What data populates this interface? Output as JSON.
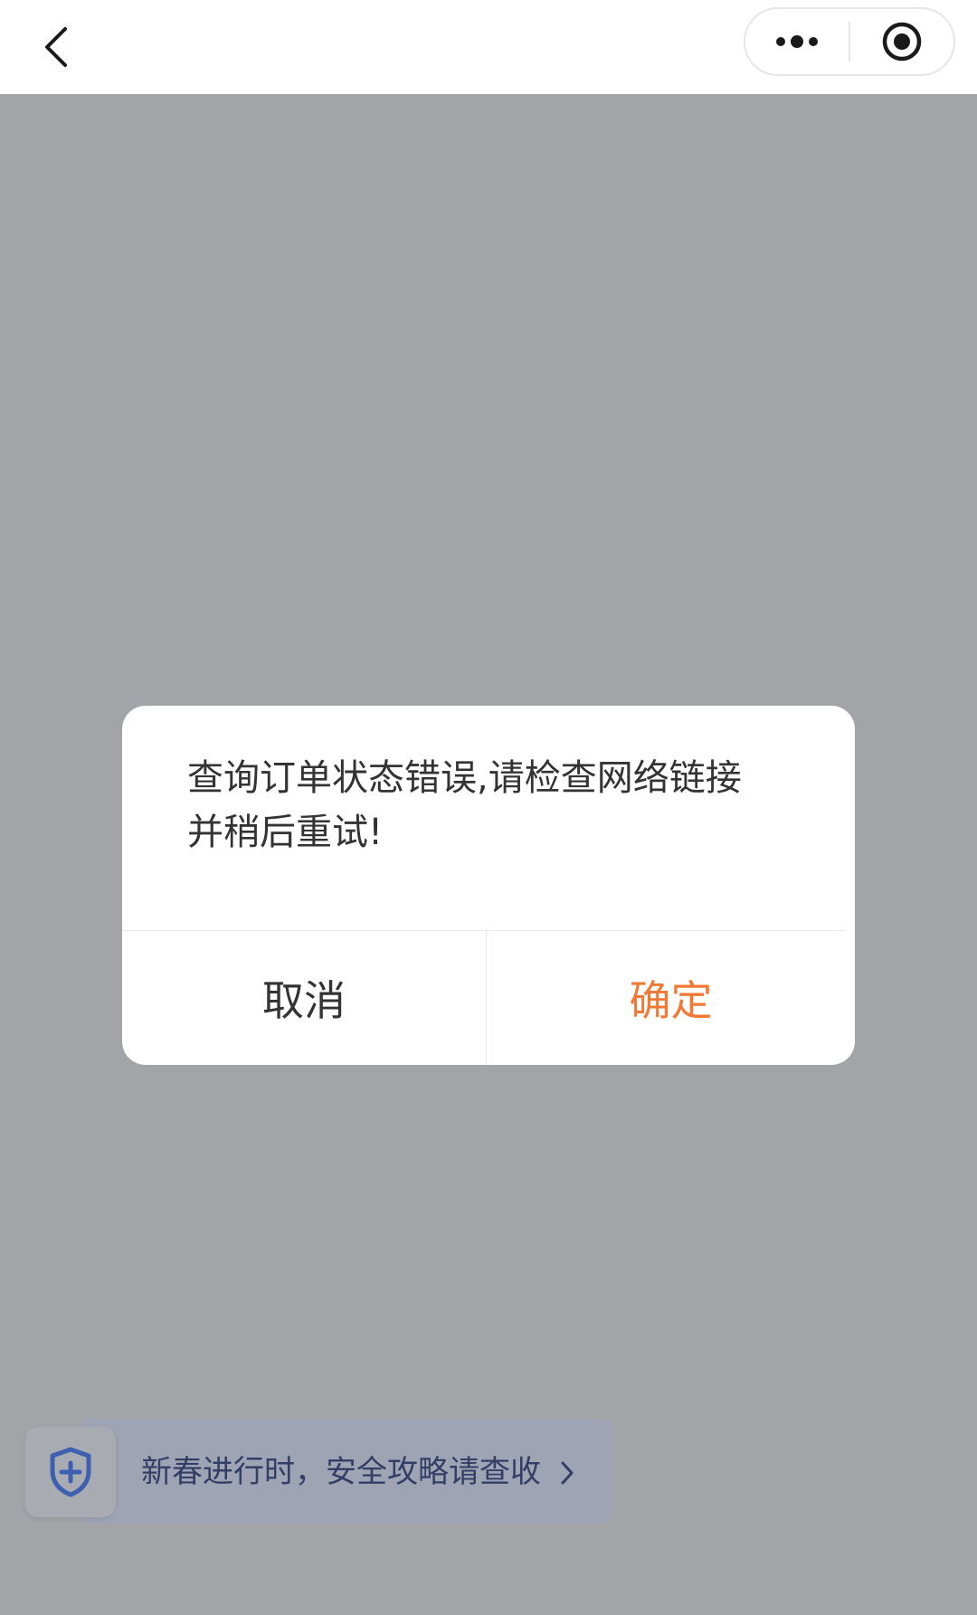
{
  "dialog": {
    "message": "查询订单状态错误,请检查网络链接并稍后重试!",
    "cancel_label": "取消",
    "confirm_label": "确定"
  },
  "banner": {
    "text": "新春进行时，安全攻略请查收"
  },
  "icons": {
    "back": "chevron-left-icon",
    "more": "more-dots-icon",
    "close": "target-circle-icon",
    "shield": "shield-plus-icon",
    "arrow": "chevron-right-icon"
  },
  "colors": {
    "overlay": "#a3a4a8",
    "confirm": "#f07a35",
    "banner_text": "#333e66",
    "shield": "#3d5fb0"
  }
}
